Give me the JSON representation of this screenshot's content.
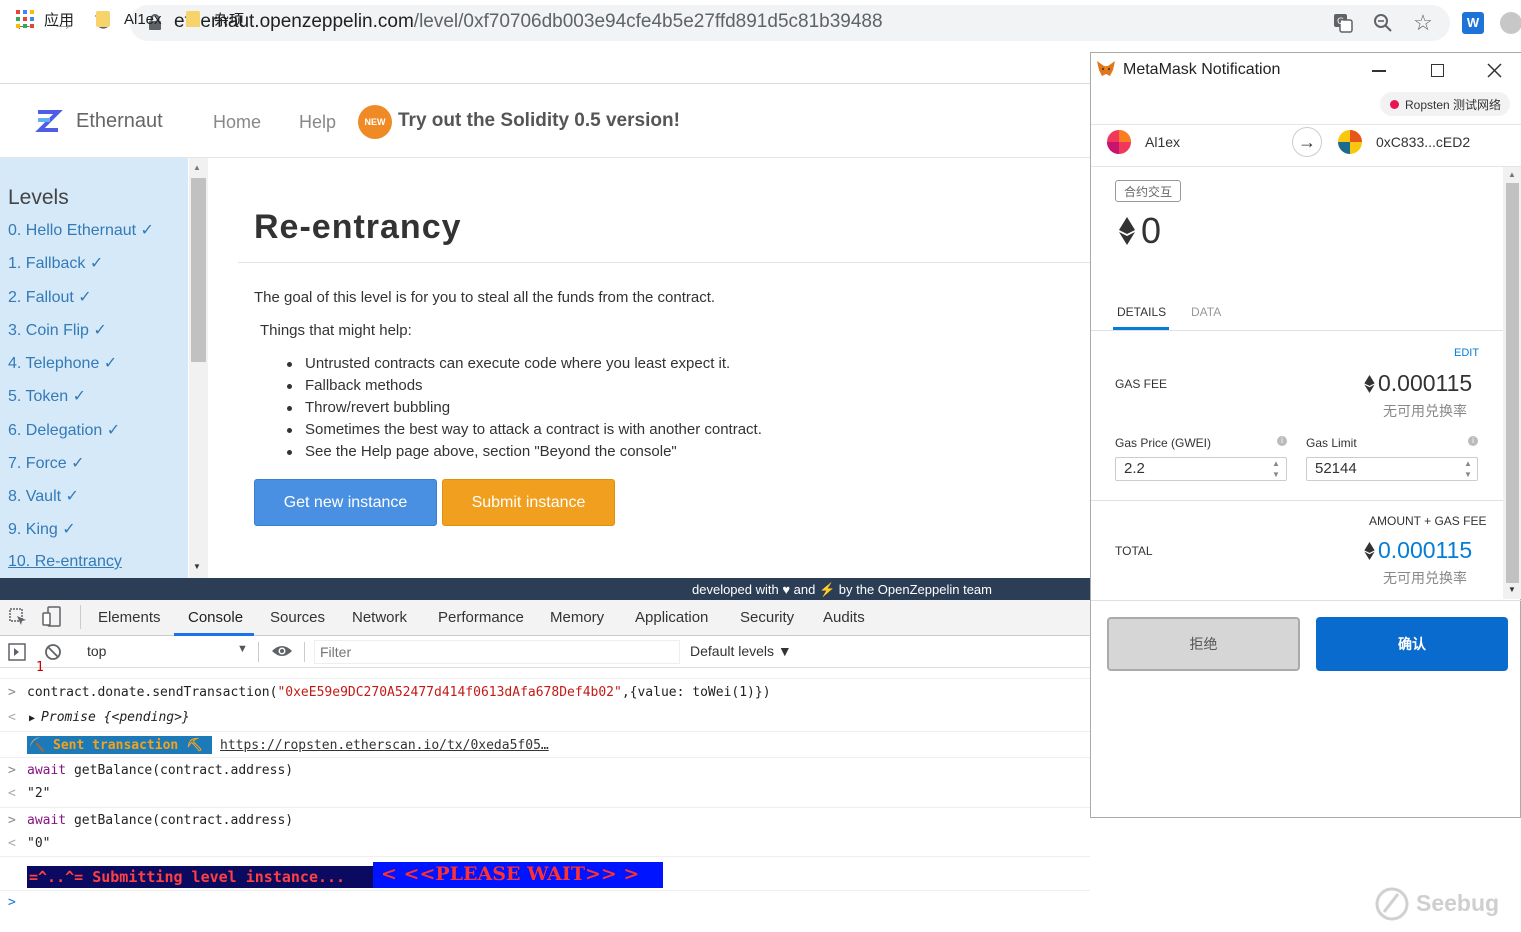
{
  "browser": {
    "url_host": "ethernaut.openzeppelin.com",
    "url_path": "/level/0xf70706db003e94cfe4b5e27ffd891d5c81b39488",
    "bookmarks": [
      "应用",
      "Al1ex",
      "杂项"
    ]
  },
  "site": {
    "brand": "Ethernaut",
    "nav": [
      "Home",
      "Help"
    ],
    "badge": "NEW",
    "promo": "Try out the Solidity 0.5 version!",
    "footer": "developed with ♥ and ⚡ by the OpenZeppelin team"
  },
  "sidebar": {
    "title": "Levels",
    "items": [
      {
        "label": "0. Hello Ethernaut ✓"
      },
      {
        "label": "1. Fallback ✓"
      },
      {
        "label": "2. Fallout ✓"
      },
      {
        "label": "3. Coin Flip ✓"
      },
      {
        "label": "4. Telephone ✓"
      },
      {
        "label": "5. Token ✓"
      },
      {
        "label": "6. Delegation ✓"
      },
      {
        "label": "7. Force ✓"
      },
      {
        "label": "8. Vault ✓"
      },
      {
        "label": "9. King ✓"
      },
      {
        "label": "10. Re-entrancy"
      }
    ]
  },
  "level": {
    "title": "Re-entrancy",
    "goal": "The goal of this level is for you to steal all the funds from the contract.",
    "hint_title": "Things that might help:",
    "hints": [
      "Untrusted contracts can execute code where you least expect it.",
      "Fallback methods",
      "Throw/revert bubbling",
      "Sometimes the best way to attack a contract is with another contract.",
      "See the Help page above, section \"Beyond the console\""
    ],
    "btn_new": "Get new instance",
    "btn_submit": "Submit instance"
  },
  "devtools": {
    "tabs": [
      "Elements",
      "Console",
      "Sources",
      "Network",
      "Performance",
      "Memory",
      "Application",
      "Security",
      "Audits"
    ],
    "context": "top",
    "filter_placeholder": "Filter",
    "levels": "Default levels ▼",
    "console": {
      "cmd1_pre": "contract.donate.sendTransaction(",
      "cmd1_str": "\"0xeE59e9DC270A52477d414f0613dAfa678Def4b02\"",
      "cmd1_post": ",{value: toWei(1)})",
      "promise": "Promise {<pending>}",
      "sent": "⛏️ Sent transaction ⛏",
      "sent_link": "https://ropsten.etherscan.io/tx/0xeda5f05…",
      "await_kw": "await",
      "cmd2": " getBalance(contract.address)",
      "res2": "\"2\"",
      "res3": "\"0\"",
      "submitting": "=^..^= Submitting level instance...",
      "wait": "<  <<PLEASE WAIT>> >"
    }
  },
  "metamask": {
    "title": "MetaMask Notification",
    "network": "Ropsten 测试网络",
    "from": "Al1ex",
    "to": "0xC833...cED2",
    "tag": "合约交互",
    "amount": "0",
    "tabs": [
      "DETAILS",
      "DATA"
    ],
    "edit": "EDIT",
    "gas_fee_label": "GAS FEE",
    "gas_fee": "0.000115",
    "no_rate": "无可用兑换率",
    "gas_price_label": "Gas Price (GWEI)",
    "gas_price": "2.2",
    "gas_limit_label": "Gas Limit",
    "gas_limit": "52144",
    "amount_gas_label": "AMOUNT + GAS FEE",
    "total_label": "TOTAL",
    "total": "0.000115",
    "reject": "拒绝",
    "confirm": "确认"
  },
  "watermark": "Seebug"
}
